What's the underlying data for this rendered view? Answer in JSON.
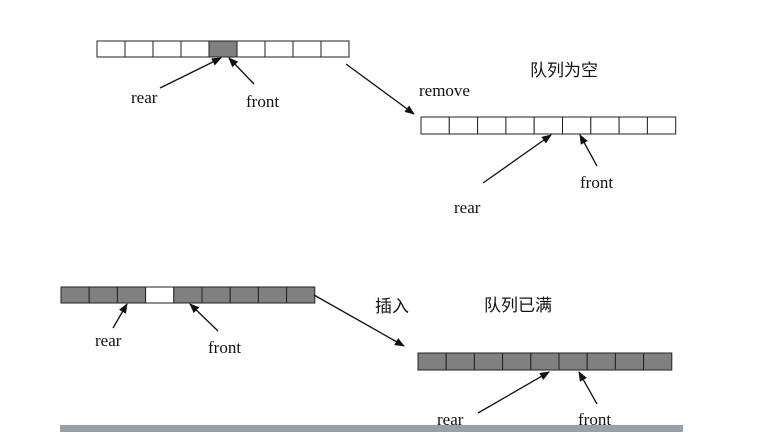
{
  "colors": {
    "empty": "#ffffff",
    "filled": "#808080",
    "bar": "#9aa0a8"
  },
  "panels": [
    {
      "cells": [
        0,
        0,
        0,
        0,
        1,
        0,
        0,
        0,
        0
      ],
      "labels": {
        "rear": "rear",
        "front": "front"
      }
    },
    {
      "cells": [
        0,
        0,
        0,
        0,
        0,
        0,
        0,
        0,
        0
      ],
      "labels": {
        "rear": "rear",
        "front": "front"
      }
    },
    {
      "cells": [
        1,
        1,
        1,
        0,
        1,
        1,
        1,
        1,
        1
      ],
      "labels": {
        "rear": "rear",
        "front": "front"
      }
    },
    {
      "cells": [
        1,
        1,
        1,
        1,
        1,
        1,
        1,
        1,
        1
      ],
      "labels": {
        "rear": "rear",
        "front": "front"
      }
    }
  ],
  "transitions": [
    {
      "action": "remove",
      "result": "队列为空"
    },
    {
      "action": "插入",
      "result": "队列已满"
    }
  ]
}
